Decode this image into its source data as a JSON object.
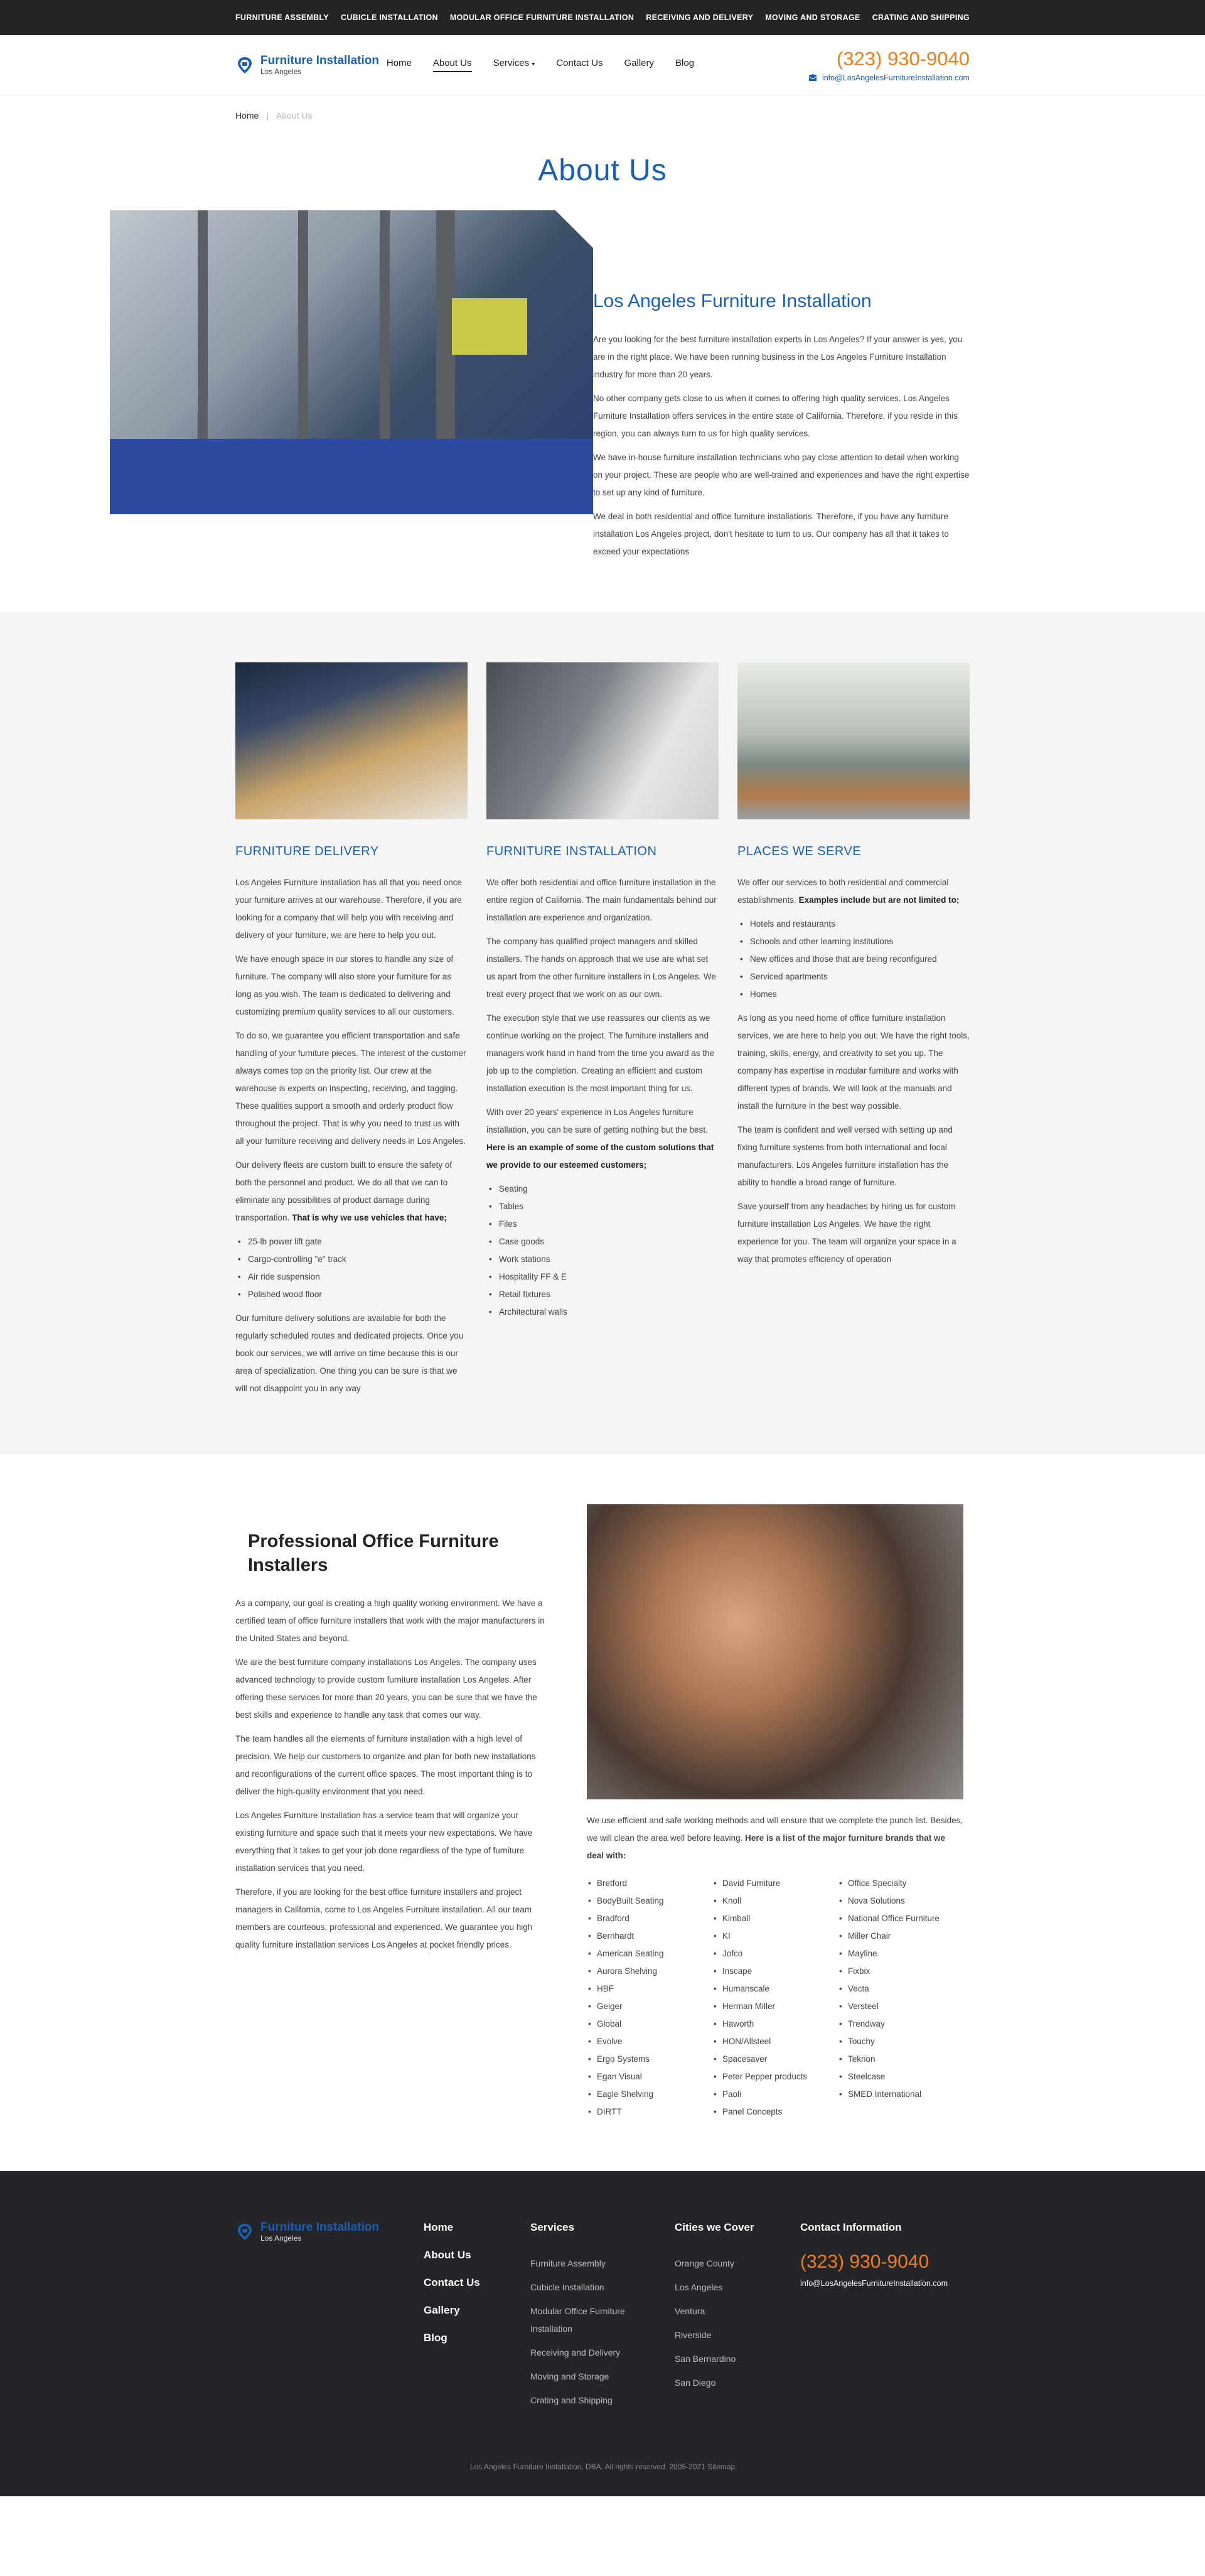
{
  "topbar": {
    "links": [
      "FURNITURE ASSEMBLY",
      "CUBICLE INSTALLATION",
      "MODULAR OFFICE FURNITURE INSTALLATION",
      "RECEIVING AND DELIVERY",
      "MOVING AND STORAGE",
      "CRATING AND SHIPPING"
    ]
  },
  "header": {
    "logo_name": "Furniture Installation",
    "logo_sub": "Los Angeles",
    "nav": [
      "Home",
      "About Us",
      "Services",
      "Contact Us",
      "Gallery",
      "Blog"
    ],
    "services_caret": "▾",
    "phone": "(323) 930-9040",
    "email": "info@LosAngelesFurnitureInstallation.com"
  },
  "breadcrumb": {
    "home": "Home",
    "sep": "|",
    "current": "About Us"
  },
  "page_title": "About Us",
  "about": {
    "heading": "Los Angeles Furniture Installation",
    "paragraphs": [
      "Are you looking for the best furniture installation experts in Los Angeles? If your answer is yes, you are in the right place. We have been running business in the Los Angeles Furniture Installation industry for more than 20 years.",
      "No other company gets close to us when it comes to offering high quality services. Los Angeles Furniture Installation offers services in the entire state of California. Therefore, if you reside in this region, you can always turn to us for high quality services.",
      "We have in-house furniture installation technicians who pay close attention to detail when working on your project. These are people who are well-trained and experiences and have the right expertise to set up any kind of furniture.",
      "We deal in both residential and office furniture installations. Therefore, if you have any furniture installation Los Angeles project, don't hesitate to turn to us. Our company has all that it takes to exceed your expectations"
    ]
  },
  "services": {
    "delivery": {
      "title": "FURNITURE DELIVERY",
      "p1": "Los Angeles Furniture Installation has all that you need once your furniture arrives at our warehouse. Therefore, if you are looking for a company that will help you with receiving and delivery of your furniture, we are here to help you out.",
      "p2": "We have enough space in our stores to handle any size of furniture. The company will also store your furniture for as long as you wish. The team is dedicated to delivering and customizing premium quality services to all our customers.",
      "p3": "To do so, we guarantee you efficient transportation and safe handling of your furniture pieces. The interest of the customer always comes top on the priority list. Our crew at the warehouse is experts on inspecting, receiving, and tagging. These qualities support a smooth and orderly product flow throughout the project. That is why you need to trust us with all your furniture receiving and delivery needs in Los Angeles.",
      "p4": "Our delivery fleets are custom built to ensure the safety of both the personnel and product. We do all that we can to eliminate any possibilities of product damage during transportation.",
      "p4_bold": "That is why we use vehicles that have;",
      "list": [
        "25-lb power lift gate",
        "Cargo-controlling \"e\" track",
        "Air ride suspension",
        "Polished wood floor"
      ],
      "p5": "Our furniture delivery solutions are available for both the regularly scheduled routes and dedicated projects. Once you book our services, we will arrive on time because this is our area of specialization. One thing you can be sure is that we will not disappoint you in any way"
    },
    "installation": {
      "title": "FURNITURE INSTALLATION",
      "p1": "We offer both residential and office furniture installation in the entire region of California. The main fundamentals behind our installation are experience and organization.",
      "p2": "The company has qualified project managers and skilled installers. The hands on approach that we use are what set us apart from the other furniture installers in Los Angeles. We treat every project that we work on as our own.",
      "p3": "The execution style that we use reassures our clients as we continue working on the project. The furniture installers and managers work hand in hand from the time you award as the job up to the completion. Creating an efficient and custom installation execution is the most important thing for us.",
      "p4": "With over 20 years' experience in Los Angeles furniture installation, you can be sure of getting nothing but the best.",
      "p4_bold": "Here is an example of some of the custom solutions that we provide to our esteemed customers;",
      "list": [
        "Seating",
        "Tables",
        "Files",
        "Case goods",
        "Work stations",
        "Hospitality FF & E",
        "Retail fixtures",
        "Architectural walls"
      ]
    },
    "places": {
      "title": "PLACES WE SERVE",
      "p1": "We offer our services to both residential and commercial establishments.",
      "p1_bold": "Examples include but are not limited to;",
      "list": [
        "Hotels and restaurants",
        "Schools and other learning institutions",
        "New offices and those that are being reconfigured",
        "Serviced apartments",
        "Homes"
      ],
      "p2": "As long as you need home of office furniture installation services, we are here to help you out. We have the right tools, training, skills, energy, and creativity to set you up. The company has expertise in modular furniture and works with different types of brands. We will look at the manuals and install the furniture in the best way possible.",
      "p3": "The team is confident and well versed with setting up and fixing furniture systems from both international and local manufacturers. Los Angeles furniture installation has the ability to handle a broad range of furniture.",
      "p4": "Save yourself from any headaches by hiring us for custom furniture installation Los Angeles. We have the right experience for you. The team will organize your space in a way that promotes efficiency of operation"
    }
  },
  "pro": {
    "heading": "Professional Office Furniture Installers",
    "paragraphs": [
      "As a company, our goal is creating a high quality working environment. We have a certified team of office furniture installers that work with the major manufacturers in the United States and beyond.",
      "We are the best furniture company installations Los Angeles. The company uses advanced technology to provide custom furniture installation Los Angeles. After offering these services for more than 20 years, you can be sure that we have the best skills and experience to handle any task that comes our way.",
      "The team handles all the elements of furniture installation with a high level of precision. We help our customers to organize and plan for both new installations and reconfigurations of the current office spaces. The most important thing is to deliver the high-quality environment that you need.",
      "Los Angeles Furniture Installation has a service team that will organize your existing furniture and space such that it meets your new expectations. We have everything that it takes to get your job done regardless of the type of furniture installation services that you need.",
      "Therefore, if you are looking for the best office furniture installers and project managers in California, come to Los Angeles Furniture installation. All our team members are courteous, professional and experienced. We guarantee you high quality furniture installation services Los Angeles at pocket friendly prices."
    ],
    "right_text": "We use efficient and safe working methods and will ensure that we complete the punch list. Besides, we will clean the area well before leaving.",
    "right_bold": "Here is a list of the major furniture brands that we deal with:",
    "brands_col1": [
      "Bretford",
      "BodyBuilt Seating",
      "Bradford",
      "Bernhardt",
      "American Seating",
      "Aurora Shelving",
      "HBF",
      "Geiger",
      "Global",
      "Evolve",
      "Ergo Systems",
      "Egan Visual",
      "Eagle Shelving",
      "DIRTT"
    ],
    "brands_col2": [
      "David Furniture",
      "Knoll",
      "Kimball",
      "KI",
      "Jofco",
      "Inscape",
      "Humanscale",
      "Herman Miller",
      "Haworth",
      "HON/Allsteel",
      "Spacesaver",
      "Peter Pepper products",
      "Paoli",
      "Panel Concepts"
    ],
    "brands_col3": [
      "Office Specialty",
      "Nova Solutions",
      "National Office Furniture",
      "Miller Chair",
      "Mayline",
      "Fixbix",
      "Vecta",
      "Versteel",
      "Trendway",
      "Touchy",
      "Tekrion",
      "Steelcase",
      "SMED International"
    ]
  },
  "footer": {
    "logo_name": "Furniture Installation",
    "logo_sub": "Los Angeles",
    "main_links": [
      "Home",
      "About Us",
      "Contact Us",
      "Gallery",
      "Blog"
    ],
    "services_title": "Services",
    "services": [
      "Furniture Assembly",
      "Cubicle Installation",
      "Modular Office Furniture Installation",
      "Receiving and Delivery",
      "Moving and Storage",
      "Crating and Shipping"
    ],
    "cities_title": "Cities we Cover",
    "cities": [
      "Orange County",
      "Los Angeles",
      "Ventura",
      "Riverside",
      "San Bernardino",
      "San Diego"
    ],
    "contact_title": "Contact Information",
    "phone": "(323) 930-9040",
    "email": "info@LosAngelesFurnitureInstallation.com",
    "copyright": "Los Angeles Furniture Installation, DBA. All rights reserved. 2005-2021 Sitemap"
  },
  "colors": {
    "brand_blue": "#1a5fb4",
    "accent_orange": "#ef7d1a",
    "dark": "#242528"
  }
}
